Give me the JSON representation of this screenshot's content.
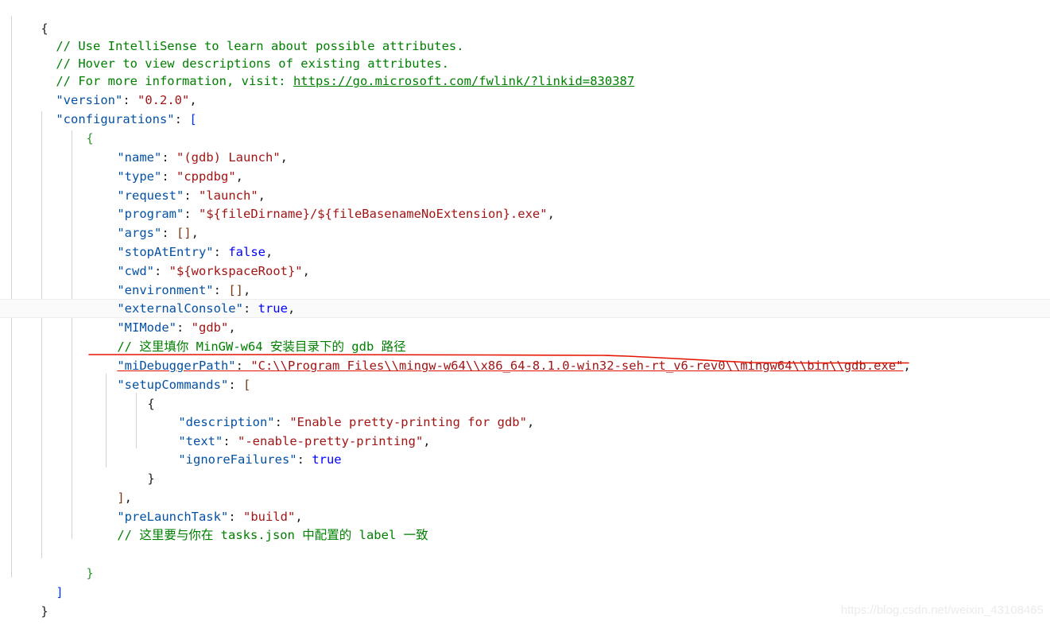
{
  "editor": {
    "file_kind": "json-config",
    "background_color": "#ffffff",
    "current_line_index": 13,
    "colors": {
      "comment": "#008000",
      "key": "#0451a5",
      "string": "#a31515",
      "keyword": "#0000ff",
      "punctuation": "#1f1f1f",
      "indent_guide": "#d3d3d3",
      "current_line_highlight": "#fafafa",
      "annotation_red": "#e51400",
      "watermark": "#ebebeb"
    },
    "lines": [
      {
        "n": 1,
        "indent": 0,
        "text": "{"
      },
      {
        "n": 2,
        "indent": 1,
        "text": "// Use IntelliSense to learn about possible attributes."
      },
      {
        "n": 3,
        "indent": 1,
        "text": "// Hover to view descriptions of existing attributes."
      },
      {
        "n": 4,
        "indent": 1,
        "text": "// For more information, visit: https://go.microsoft.com/fwlink/?linkid=830387"
      },
      {
        "n": 5,
        "indent": 1,
        "text": "\"version\": \"0.2.0\","
      },
      {
        "n": 6,
        "indent": 1,
        "text": "\"configurations\": ["
      },
      {
        "n": 7,
        "indent": 2,
        "text": "{"
      },
      {
        "n": 8,
        "indent": 3,
        "text": "\"name\": \"(gdb) Launch\","
      },
      {
        "n": 9,
        "indent": 3,
        "text": "\"type\": \"cppdbg\","
      },
      {
        "n": 10,
        "indent": 3,
        "text": "\"request\": \"launch\","
      },
      {
        "n": 11,
        "indent": 3,
        "text": "\"program\": \"${fileDirname}/${fileBasenameNoExtension}.exe\","
      },
      {
        "n": 12,
        "indent": 3,
        "text": "\"args\": [],"
      },
      {
        "n": 13,
        "indent": 3,
        "text": "\"stopAtEntry\": false,"
      },
      {
        "n": 14,
        "indent": 3,
        "text": "\"cwd\": \"${workspaceRoot}\","
      },
      {
        "n": 15,
        "indent": 3,
        "text": "\"environment\": [],"
      },
      {
        "n": 16,
        "indent": 3,
        "text": "\"externalConsole\": true,"
      },
      {
        "n": 17,
        "indent": 3,
        "text": "\"MIMode\": \"gdb\","
      },
      {
        "n": 18,
        "indent": 3,
        "text": "// 这里填你 MinGW-w64 安装目录下的 gdb 路径"
      },
      {
        "n": 19,
        "indent": 3,
        "text": "\"miDebuggerPath\": \"C:\\\\Program Files\\\\mingw-w64\\\\x86_64-8.1.0-win32-seh-rt_v6-rev0\\\\mingw64\\\\bin\\\\gdb.exe\","
      },
      {
        "n": 20,
        "indent": 3,
        "text": "\"setupCommands\": ["
      },
      {
        "n": 21,
        "indent": 4,
        "text": "{"
      },
      {
        "n": 22,
        "indent": 5,
        "text": "\"description\": \"Enable pretty-printing for gdb\","
      },
      {
        "n": 23,
        "indent": 5,
        "text": "\"text\": \"-enable-pretty-printing\","
      },
      {
        "n": 24,
        "indent": 5,
        "text": "\"ignoreFailures\": true"
      },
      {
        "n": 25,
        "indent": 4,
        "text": "}"
      },
      {
        "n": 26,
        "indent": 3,
        "text": "],"
      },
      {
        "n": 27,
        "indent": 3,
        "text": "\"preLaunchTask\": \"build\","
      },
      {
        "n": 28,
        "indent": 3,
        "text": "// 这里要与你在 tasks.json 中配置的 label 一致"
      },
      {
        "n": 29,
        "indent": 0,
        "text": ""
      },
      {
        "n": 30,
        "indent": 2,
        "text": "}"
      },
      {
        "n": 31,
        "indent": 1,
        "text": "]"
      },
      {
        "n": 32,
        "indent": 0,
        "text": "}"
      }
    ]
  },
  "code_tokens": {
    "l1": {
      "brace": "{"
    },
    "l2": {
      "comment": "// Use IntelliSense to learn about possible attributes."
    },
    "l3": {
      "comment": "// Hover to view descriptions of existing attributes."
    },
    "l4": {
      "comment_prefix": "// For more information, visit: ",
      "link": "https://go.microsoft.com/fwlink/?linkid=830387"
    },
    "l5": {
      "key": "\"version\"",
      "colon": ": ",
      "value": "\"0.2.0\"",
      "tail": ","
    },
    "l6": {
      "key": "\"configurations\"",
      "colon": ": ",
      "bracket": "["
    },
    "l7": {
      "brace": "{"
    },
    "l8": {
      "key": "\"name\"",
      "colon": ": ",
      "value": "\"(gdb) Launch\"",
      "tail": ","
    },
    "l9": {
      "key": "\"type\"",
      "colon": ": ",
      "value": "\"cppdbg\"",
      "tail": ","
    },
    "l10": {
      "key": "\"request\"",
      "colon": ": ",
      "value": "\"launch\"",
      "tail": ","
    },
    "l11": {
      "key": "\"program\"",
      "colon": ": ",
      "value": "\"${fileDirname}/${fileBasenameNoExtension}.exe\"",
      "tail": ","
    },
    "l12": {
      "key": "\"args\"",
      "colon": ": ",
      "value": "[]",
      "tail": ","
    },
    "l13": {
      "key": "\"stopAtEntry\"",
      "colon": ": ",
      "value": "false",
      "tail": ","
    },
    "l14": {
      "key": "\"cwd\"",
      "colon": ": ",
      "value": "\"${workspaceRoot}\"",
      "tail": ","
    },
    "l15": {
      "key": "\"environment\"",
      "colon": ": ",
      "value": "[]",
      "tail": ","
    },
    "l16": {
      "key": "\"externalConsole\"",
      "colon": ": ",
      "value": "true",
      "tail": ","
    },
    "l17": {
      "key": "\"MIMode\"",
      "colon": ": ",
      "value": "\"gdb\"",
      "tail": ","
    },
    "l18": {
      "comment": "// 这里填你 MinGW-w64 安装目录下的 gdb 路径"
    },
    "l19": {
      "key": "\"miDebuggerPath\"",
      "colon": ": ",
      "value": "\"C:\\\\Program Files\\\\mingw-w64\\\\x86_64-8.1.0-win32-seh-rt_v6-rev0\\\\mingw64\\\\bin\\\\gdb.exe\"",
      "tail": ","
    },
    "l20": {
      "key": "\"setupCommands\"",
      "colon": ": ",
      "bracket": "["
    },
    "l21": {
      "brace": "{"
    },
    "l22": {
      "key": "\"description\"",
      "colon": ": ",
      "value": "\"Enable pretty-printing for gdb\"",
      "tail": ","
    },
    "l23": {
      "key": "\"text\"",
      "colon": ": ",
      "value": "\"-enable-pretty-printing\"",
      "tail": ","
    },
    "l24": {
      "key": "\"ignoreFailures\"",
      "colon": ": ",
      "value": "true",
      "tail": ""
    },
    "l25": {
      "brace": "}"
    },
    "l26": {
      "bracket": "]",
      "tail": ","
    },
    "l27": {
      "key": "\"preLaunchTask\"",
      "colon": ": ",
      "value": "\"build\"",
      "tail": ","
    },
    "l28": {
      "comment": "// 这里要与你在 tasks.json 中配置的 label 一致"
    },
    "l30": {
      "brace": "}"
    },
    "l31": {
      "bracket": "]"
    },
    "l32": {
      "brace": "}"
    }
  },
  "annotation": {
    "kind": "hand-drawn-underline",
    "color": "#e51400",
    "target_line": 19,
    "description": "red marker underline drawn beneath the miDebuggerPath value"
  },
  "watermark": {
    "text": "https://blog.csdn.net/weixin_43108465"
  }
}
